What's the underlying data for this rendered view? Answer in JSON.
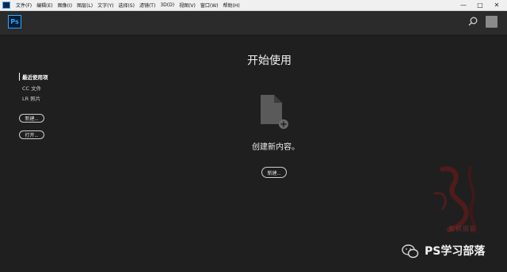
{
  "menubar": {
    "items": [
      "文件(F)",
      "编辑(E)",
      "图像(I)",
      "图层(L)",
      "文字(Y)",
      "选择(S)",
      "滤镜(T)",
      "3D(D)",
      "视图(V)",
      "窗口(W)",
      "帮助(H)"
    ],
    "window_controls": {
      "minimize": "—",
      "maximize": "□",
      "close": "✕"
    }
  },
  "topbar": {
    "logo_text": "Ps"
  },
  "sidebar": {
    "recent_label": "最近使用项",
    "items": [
      "CC 文件",
      "LR 照片"
    ],
    "new_button": "新建...",
    "open_button": "打开..."
  },
  "main": {
    "title": "开始使用",
    "create_text": "创建新内容。",
    "new_button": "新建..."
  },
  "watermark": {
    "seal_text": "紫枫摄影",
    "brand_text": "PS学习部落"
  },
  "colors": {
    "ps_accent": "#31a8ff",
    "background": "#1f1f1f",
    "topbar": "#2b2b2b"
  }
}
